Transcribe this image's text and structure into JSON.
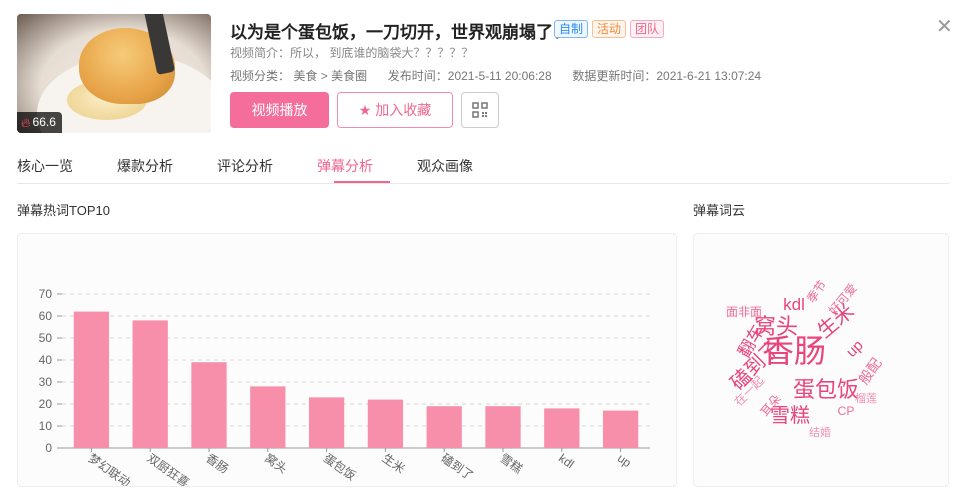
{
  "video": {
    "heat": "66.6",
    "title": "以为是个蛋包饭，一刀切开，世界观崩塌了！",
    "tags": [
      "自制",
      "活动",
      "团队"
    ],
    "description": "视频简介：所以， 到底谁的脑袋大？？？？？",
    "category_label": "视频分类：",
    "category_main": "美食",
    "category_sep": ">",
    "category_sub": "美食圈",
    "publish_time": "发布时间：2021-5-11 20:06:28",
    "update_time": "数据更新时间：2021-6-21 13:07:24"
  },
  "actions": {
    "play_label": "视频播放",
    "fav_label": "加入收藏"
  },
  "tabs": [
    {
      "label": "核心一览",
      "active": false
    },
    {
      "label": "爆款分析",
      "active": false
    },
    {
      "label": "评论分析",
      "active": false
    },
    {
      "label": "弹幕分析",
      "active": true
    },
    {
      "label": "观众画像",
      "active": false
    }
  ],
  "sections": {
    "chart_title": "弹幕热词TOP10",
    "cloud_title": "弹幕词云"
  },
  "colors": {
    "accent": "#f0668e",
    "bar": "#f78fab",
    "tag_blue": "#2d8cf0",
    "tag_orange": "#f28a3c",
    "tag_pink": "#f0668e"
  },
  "chart_data": {
    "type": "bar",
    "categories": [
      "梦幻联动",
      "双厨狂喜",
      "香肠",
      "窝头",
      "蛋包饭",
      "生米",
      "磕到了",
      "雪糕",
      "kdl",
      "up"
    ],
    "values": [
      62,
      58,
      39,
      28,
      23,
      22,
      19,
      19,
      18,
      17
    ],
    "ylim": [
      0,
      70
    ],
    "yticks": [
      0,
      10,
      20,
      30,
      40,
      50,
      60,
      70
    ],
    "grid": true,
    "title": "",
    "xlabel": "",
    "ylabel": ""
  },
  "word_cloud": [
    {
      "text": "香肠",
      "weight": 10
    },
    {
      "text": "窝头",
      "weight": 7
    },
    {
      "text": "生米",
      "weight": 6
    },
    {
      "text": "蛋包饭",
      "weight": 7
    },
    {
      "text": "磕到了",
      "weight": 6
    },
    {
      "text": "雪糕",
      "weight": 6
    },
    {
      "text": "kdl",
      "weight": 5
    },
    {
      "text": "up",
      "weight": 5
    },
    {
      "text": "翻车",
      "weight": 4
    },
    {
      "text": "般配",
      "weight": 3
    },
    {
      "text": "面非面",
      "weight": 2
    },
    {
      "text": "季节",
      "weight": 2
    },
    {
      "text": "好可爱",
      "weight": 2
    },
    {
      "text": "在一起",
      "weight": 2
    },
    {
      "text": "耳朵",
      "weight": 2
    },
    {
      "text": "CP",
      "weight": 2
    },
    {
      "text": "榴莲",
      "weight": 2
    },
    {
      "text": "结婚",
      "weight": 2
    }
  ]
}
